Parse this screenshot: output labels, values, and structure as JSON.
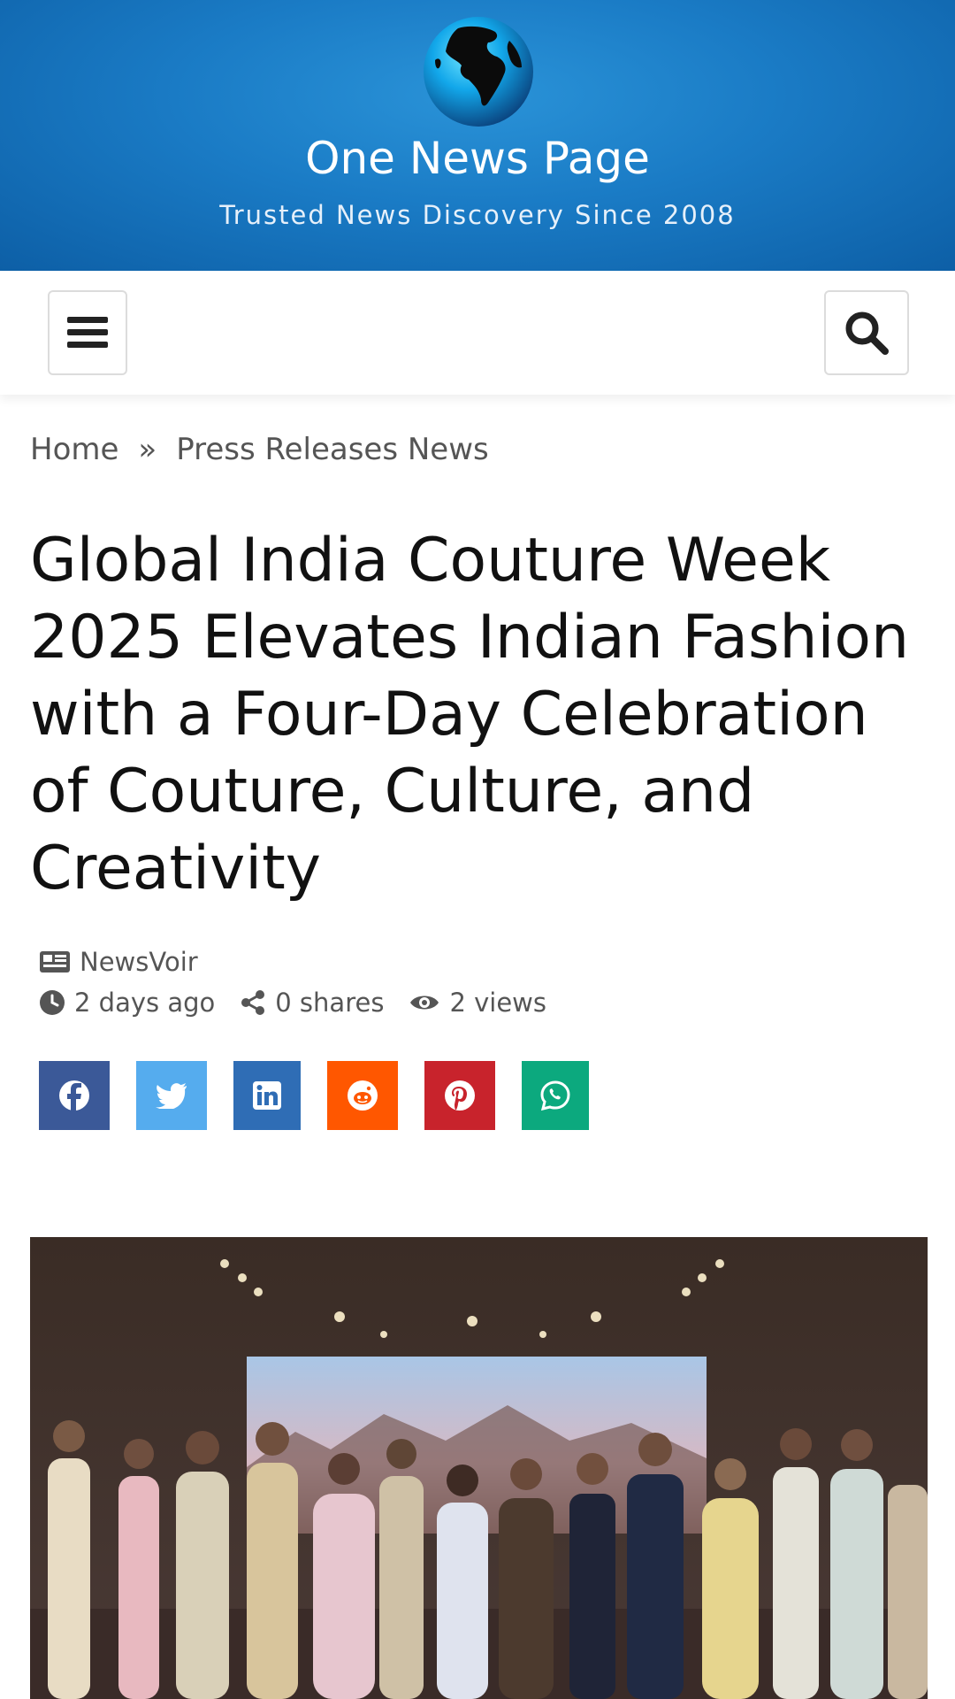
{
  "header": {
    "site_title": "One News Page",
    "tagline": "Trusted News Discovery Since 2008",
    "logo_icon": "globe-icon"
  },
  "nav": {
    "menu_icon": "hamburger-menu-icon",
    "search_icon": "search-icon"
  },
  "breadcrumb": {
    "items": [
      "Home",
      "Press Releases News"
    ],
    "separator": "»"
  },
  "article": {
    "title": "Global India Couture Week 2025 Elevates Indian Fashion with a Four-Day Celebration of Couture, Culture, and Creativity",
    "source": "NewsVoir",
    "time_ago": "2 days ago",
    "shares": "0 shares",
    "views": "2 views"
  },
  "share_buttons": [
    {
      "network": "facebook",
      "icon": "facebook-icon",
      "color": "#3b5998"
    },
    {
      "network": "twitter",
      "icon": "twitter-icon",
      "color": "#55acee"
    },
    {
      "network": "linkedin",
      "icon": "linkedin-icon",
      "color": "#2f6db5"
    },
    {
      "network": "reddit",
      "icon": "reddit-icon",
      "color": "#ff5700"
    },
    {
      "network": "pinterest",
      "icon": "pinterest-icon",
      "color": "#c8232c"
    },
    {
      "network": "whatsapp",
      "icon": "whatsapp-icon",
      "color": "#0ca97e"
    }
  ],
  "colors": {
    "header_blue": "#1a7bc5",
    "text_dark": "#111111",
    "text_muted": "#555555"
  }
}
